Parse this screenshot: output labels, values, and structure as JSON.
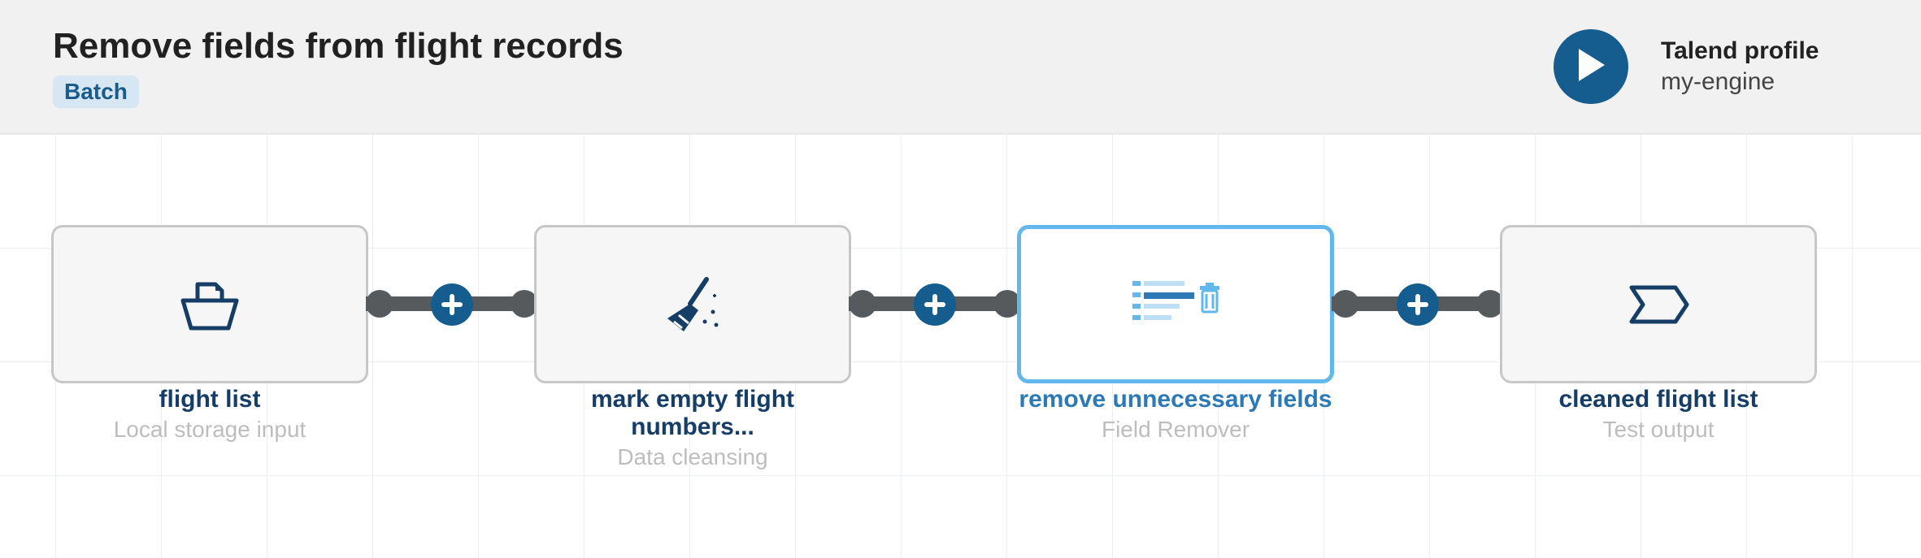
{
  "header": {
    "title": "Remove fields from flight records",
    "badge": "Batch",
    "profile_label": "Talend profile",
    "profile_value": "my-engine"
  },
  "nodes": [
    {
      "name": "flight list",
      "subtype": "Local storage input",
      "selected": false,
      "icon": "file-tray"
    },
    {
      "name": "mark empty flight numbers...",
      "subtype": "Data cleansing",
      "selected": false,
      "icon": "broom"
    },
    {
      "name": "remove unnecessary fields",
      "subtype": "Field Remover",
      "selected": true,
      "icon": "field-remove"
    },
    {
      "name": "cleaned flight list",
      "subtype": "Test output",
      "selected": false,
      "icon": "bookmark-out"
    }
  ],
  "colors": {
    "brand": "#155d8e",
    "node_title": "#163d66",
    "selected_border": "#62b7ec"
  }
}
